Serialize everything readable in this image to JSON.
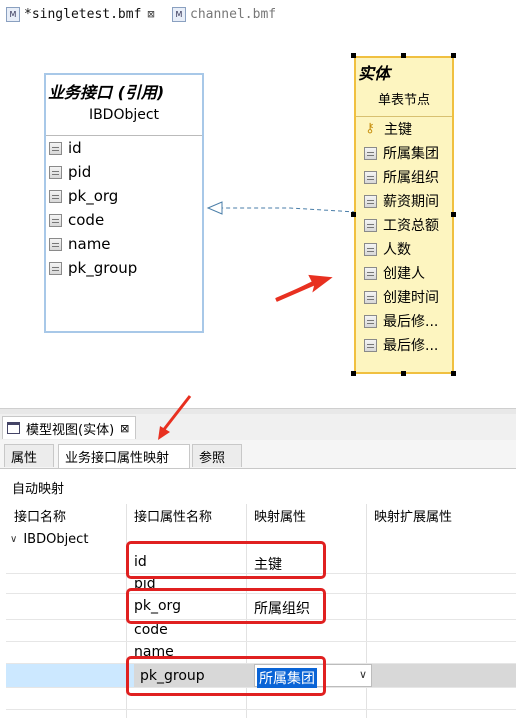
{
  "editor_tabs": [
    {
      "icon": "M",
      "label": "*singletest.bmf",
      "close": "⊠"
    },
    {
      "icon": "M",
      "label": "channel.bmf"
    }
  ],
  "interface_box": {
    "title": "业务接口 (引用)",
    "subtitle": "IBDObject",
    "attributes": [
      "id",
      "pid",
      "pk_org",
      "code",
      "name",
      "pk_group"
    ]
  },
  "entity_box": {
    "title": "实体",
    "subtitle": "单表节点",
    "attributes": [
      "主键",
      "所属集团",
      "所属组织",
      "薪资期间",
      "工资总额",
      "人数",
      "创建人",
      "创建时间",
      "最后修...",
      "最后修..."
    ]
  },
  "view_tab": {
    "label": "模型视图(实体)",
    "close": "⊠"
  },
  "sub_tabs": [
    "属性",
    "业务接口属性映射",
    "参照"
  ],
  "auto_map_label": "自动映射",
  "table": {
    "headers": [
      "接口名称",
      "接口属性名称",
      "映射属性",
      "映射扩展属性"
    ],
    "tree_node": "IBDObject",
    "rows": [
      {
        "attr": "id",
        "mapped": "主键"
      },
      {
        "attr": "pid",
        "mapped": ""
      },
      {
        "attr": "pk_org",
        "mapped": "所属组织"
      },
      {
        "attr": "code",
        "mapped": ""
      },
      {
        "attr": "name",
        "mapped": ""
      },
      {
        "attr": "pk_group",
        "mapped": "所属集团"
      }
    ]
  },
  "colors": {
    "highlight_red": "#e02020",
    "entity_fill": "#fdf5c0",
    "entity_border": "#f0c040",
    "iface_border": "#a8c8e8",
    "selection_blue": "#0a64d6"
  }
}
